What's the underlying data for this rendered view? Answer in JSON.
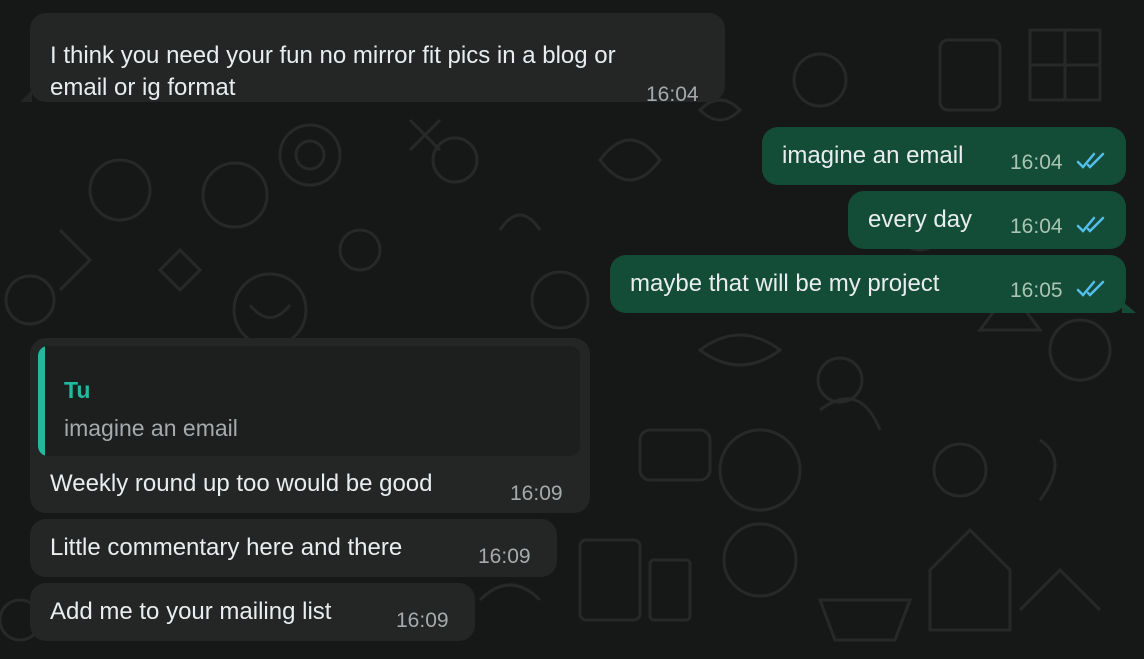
{
  "messages": [
    {
      "direction": "incoming",
      "lines": [
        "I think you need your fun no mirror fit pics in a blog or",
        "email or ig format"
      ],
      "time": "16:04"
    },
    {
      "direction": "outgoing",
      "text": "imagine an email",
      "time": "16:04",
      "status": "read"
    },
    {
      "direction": "outgoing",
      "text": "every day",
      "time": "16:04",
      "status": "read"
    },
    {
      "direction": "outgoing",
      "text": "maybe that will be my project",
      "time": "16:05",
      "status": "read"
    },
    {
      "direction": "incoming",
      "quote": {
        "author": "Tu",
        "text": "imagine an email"
      },
      "text": "Weekly round up too would be good",
      "time": "16:09"
    },
    {
      "direction": "incoming",
      "text": "Little commentary here and there",
      "time": "16:09"
    },
    {
      "direction": "incoming",
      "text": "Add me to your mailing list",
      "time": "16:09"
    }
  ],
  "colors": {
    "background": "#161717",
    "incoming_bubble": "#242626",
    "outgoing_bubble": "#144d37",
    "quote_accent": "#25b8a0",
    "read_ticks": "#53bdeb"
  },
  "icons": {
    "read_receipt": "double-check-icon"
  }
}
